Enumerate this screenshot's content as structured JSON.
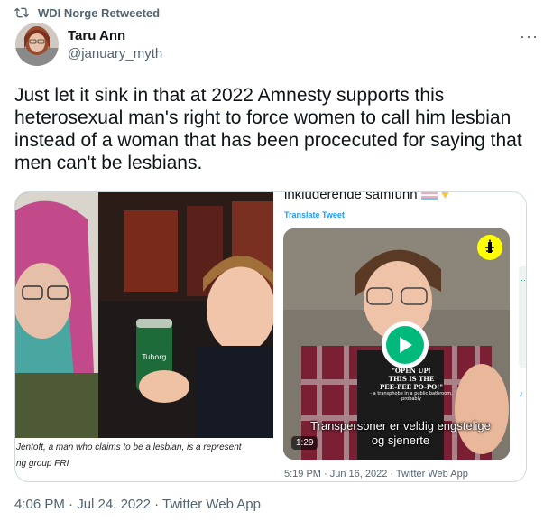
{
  "retweet": {
    "label": "WDI Norge Retweeted"
  },
  "author": {
    "name": "Taru Ann",
    "handle": "@january_myth"
  },
  "more_label": "···",
  "tweet": {
    "text": "Just let it sink in that at 2022 Amnesty supports this heterosexual man's right to force women to call him lesbian instead of a woman that has been procecuted for saying that men can't be lesbians."
  },
  "media": {
    "left_photo": {
      "caption_line1": "Jentoft, a man who claims to be a lesbian, is a represent",
      "caption_line2": "ng group FRI",
      "can_text": "Tuborg"
    },
    "embed": {
      "header": "inkluderende samfunn",
      "translate_label": "Translate Tweet",
      "video": {
        "duration": "1:29",
        "subtitle": "Transpersoner er veldig engstelige og sjenerte",
        "shirt_line1": "\"OPEN UP!",
        "shirt_line2": "THIS IS THE",
        "shirt_line3": "PEE-PEE PO-PO!\"",
        "shirt_small": "- a transphobe in a public bathroom, probably"
      },
      "footer": "5:19 PM · Jun 16, 2022 · Twitter Web App"
    }
  },
  "timestamp": {
    "time": "4:06 PM",
    "date": "Jul 24, 2022",
    "source": "Twitter Web App",
    "separator": " · "
  },
  "colors": {
    "muted": "#536471",
    "link": "#1d9bf0",
    "play_green": "#00ba7c",
    "text": "#0f1419"
  }
}
